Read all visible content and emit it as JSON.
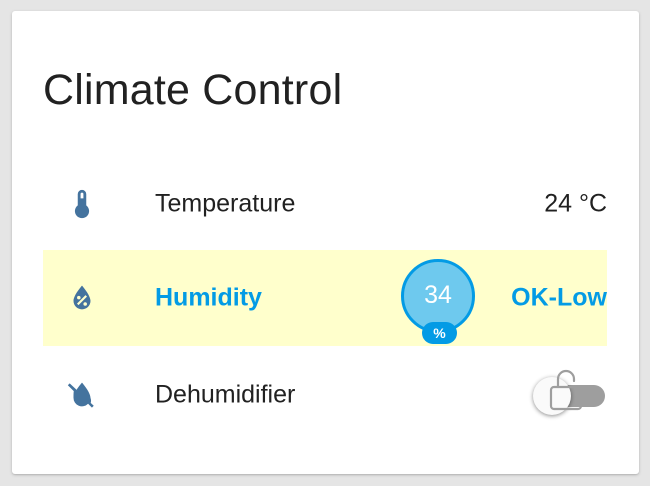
{
  "card": {
    "title": "Climate Control"
  },
  "rows": [
    {
      "label": "Temperature",
      "value": "24 °C",
      "icon": "thermometer-icon"
    },
    {
      "label": "Humidity",
      "badge_value": "34",
      "badge_unit": "%",
      "status": "OK-Low",
      "icon": "water-percent-icon",
      "highlight_color": "#ffffcc",
      "accent_color": "#039be5"
    },
    {
      "label": "Dehumidifier",
      "toggle_state": "off",
      "locked": true,
      "icon": "water-off-icon"
    }
  ],
  "colors": {
    "icon": "#44739e",
    "accent": "#039be5",
    "badge_fill": "#6ec9ee"
  }
}
